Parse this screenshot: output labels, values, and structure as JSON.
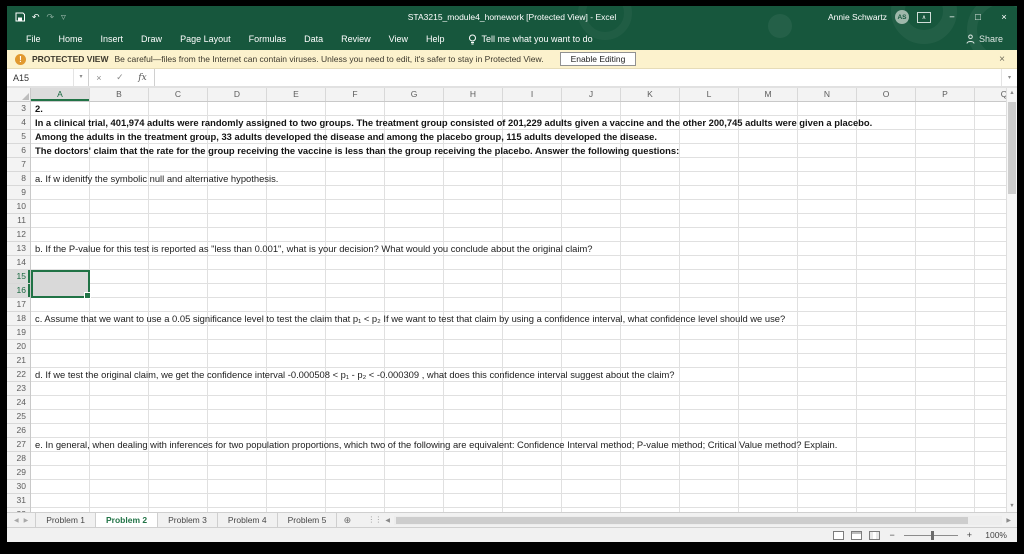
{
  "window": {
    "title": "STA3215_module4_homework  [Protected View] - Excel",
    "user_name": "Annie Schwartz",
    "user_initials": "AS",
    "minimize": "−",
    "restore": "□",
    "close": "×"
  },
  "quick_access": {
    "undo": "↶",
    "redo": "↷",
    "customize": "▽"
  },
  "ribbon": {
    "tabs": [
      "File",
      "Home",
      "Insert",
      "Draw",
      "Page Layout",
      "Formulas",
      "Data",
      "Review",
      "View",
      "Help"
    ],
    "tell_me": "Tell me what you want to do",
    "share": "Share"
  },
  "protected_view": {
    "label": "PROTECTED VIEW",
    "message": "Be careful—files from the Internet can contain viruses. Unless you need to edit, it's safer to stay in Protected View.",
    "enable_button": "Enable Editing",
    "close": "×"
  },
  "formula_bar": {
    "name_box": "A15",
    "cancel": "×",
    "enter": "✓",
    "fx": "fx",
    "value": ""
  },
  "grid": {
    "columns": [
      "A",
      "B",
      "C",
      "D",
      "E",
      "F",
      "G",
      "H",
      "I",
      "J",
      "K",
      "L",
      "M",
      "N",
      "O",
      "P",
      "Q"
    ],
    "row_start": 3,
    "row_end": 32,
    "selection": {
      "cell": "A15",
      "column": "A",
      "rows": [
        15,
        16
      ]
    },
    "cells": [
      {
        "row": 3,
        "bold": true,
        "text": "2."
      },
      {
        "row": 4,
        "bold": true,
        "text": "In a clinical trial, 401,974 adults were randomly assigned to two groups. The treatment group consisted of 201,229 adults given a vaccine and the other 200,745 adults were given a placebo."
      },
      {
        "row": 5,
        "bold": true,
        "text": "Among the adults in the treatment group, 33 adults developed the disease and among the placebo group, 115 adults developed the disease."
      },
      {
        "row": 6,
        "bold": true,
        "text": "The doctors' claim that the rate for the group receiving the vaccine is less than the group receiving the placebo. Answer the following questions:"
      },
      {
        "row": 8,
        "bold": false,
        "text": "a. If w idenitfy the symbolic null and alternative hypothesis."
      },
      {
        "row": 13,
        "bold": false,
        "text": "b. If the P-value for this test is reported as \"less than 0.001\", what is your decision? What would you conclude about the original claim?"
      },
      {
        "row": 18,
        "bold": false,
        "text": "c. Assume that we want to use a 0.05 significance level to test the claim that p₁ < p₂  If we want to test that claim by using a confidence interval, what confidence level should we use?"
      },
      {
        "row": 22,
        "bold": false,
        "text": "d. If we test the original claim, we get the confidence interval -0.000508 < p₁ - p₂ < -0.000309 , what does this confidence interval suggest about the claim?"
      },
      {
        "row": 27,
        "bold": false,
        "text": "e. In general, when dealing with inferences for two population proportions, which two of the following are equivalent: Confidence Interval method; P-value method; Critical Value method? Explain."
      }
    ]
  },
  "sheet_tabs": {
    "tabs": [
      {
        "label": "Problem 1",
        "active": false
      },
      {
        "label": "Problem 2",
        "active": true
      },
      {
        "label": "Problem 3",
        "active": false
      },
      {
        "label": "Problem 4",
        "active": false
      },
      {
        "label": "Problem 5",
        "active": false
      }
    ],
    "add_sheet": "⊕"
  },
  "status_bar": {
    "zoom": "100%",
    "zoom_out": "−",
    "zoom_in": "+"
  },
  "colors": {
    "excel_dark_green": "#17573d",
    "accent_green": "#217346",
    "warning_bar_bg": "#fcf2cd",
    "selection_fill": "#d9d9d9"
  }
}
